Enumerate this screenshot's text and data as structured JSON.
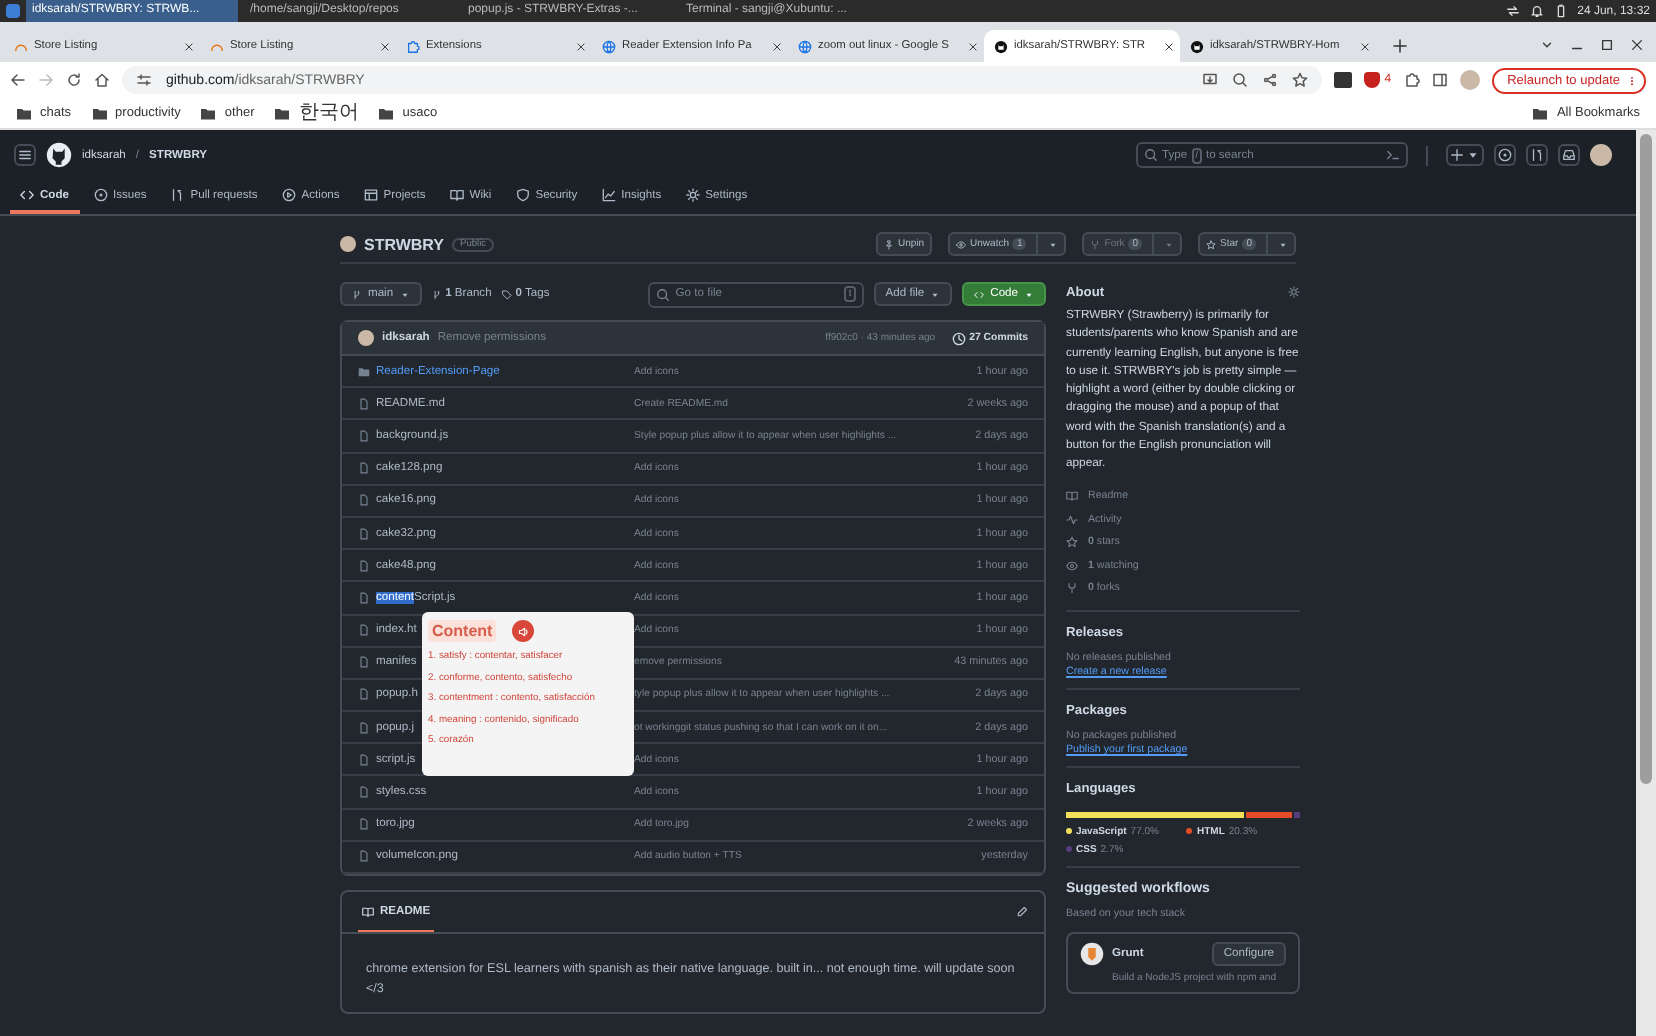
{
  "taskbar": {
    "windows": [
      {
        "title": "idksarah/STRWBRY: STRWB...",
        "selected": true
      },
      {
        "title": "/home/sangji/Desktop/repos",
        "selected": false
      },
      {
        "title": "popup.js - STRWBRY-Extras -...",
        "selected": false
      },
      {
        "title": "Terminal - sangji@Xubuntu: ...",
        "selected": false
      }
    ],
    "clock": "24 Jun, 13:32"
  },
  "browser": {
    "tabs": [
      {
        "title": "Store Listing",
        "selected": false
      },
      {
        "title": "Store Listing",
        "selected": false
      },
      {
        "title": "Extensions",
        "selected": false
      },
      {
        "title": "Reader Extension Info Pa",
        "selected": false
      },
      {
        "title": "zoom out linux - Google S",
        "selected": false
      },
      {
        "title": "idksarah/STRWBRY: STR",
        "selected": true
      },
      {
        "title": "idksarah/STRWBRY-Hom",
        "selected": false
      }
    ],
    "address": {
      "host": "github.com",
      "path": "/idksarah/STRWBRY"
    },
    "extension_badge": "4",
    "relaunch_button": "Relaunch to update",
    "bookmarks": [
      "chats",
      "productivity",
      "other",
      "한국어",
      "usaco"
    ],
    "all_bookmarks": "All Bookmarks"
  },
  "github": {
    "breadcrumb": {
      "owner": "idksarah",
      "separator": "/",
      "repo": "STRWBRY"
    },
    "search": {
      "before": "Type",
      "key": "/",
      "after": "to search"
    },
    "nav": [
      {
        "label": "Code",
        "selected": true
      },
      {
        "label": "Issues",
        "selected": false
      },
      {
        "label": "Pull requests",
        "selected": false
      },
      {
        "label": "Actions",
        "selected": false
      },
      {
        "label": "Projects",
        "selected": false
      },
      {
        "label": "Wiki",
        "selected": false
      },
      {
        "label": "Security",
        "selected": false
      },
      {
        "label": "Insights",
        "selected": false
      },
      {
        "label": "Settings",
        "selected": false
      }
    ],
    "repo": {
      "name": "STRWBRY",
      "visibility": "Public",
      "actions": [
        {
          "label": "Unpin",
          "disabled": false
        },
        {
          "label": "Unwatch",
          "count": "1",
          "disabled": false
        },
        {
          "label": "Fork",
          "count": "0",
          "disabled": true
        },
        {
          "label": "Star",
          "count": "0",
          "disabled": false
        }
      ]
    },
    "branch_bar": {
      "branch": "main",
      "branches": "**1** Branch",
      "tags": "**0** Tags",
      "go_to_file": {
        "placeholder": "Go to file",
        "key": "t"
      },
      "add_file": "Add file",
      "code_button": "Code"
    },
    "latest_commit": {
      "author": "idksarah",
      "message": "Remove permissions",
      "meta": "ff902c0 · 43 minutes ago",
      "commits": "27 Commits"
    },
    "files": [
      {
        "kind": "folder",
        "name": "Reader-Extension-Page",
        "message": "Add icons",
        "time": "1 hour ago"
      },
      {
        "kind": "file",
        "name": "README.md",
        "message": "Create README.md",
        "time": "2 weeks ago"
      },
      {
        "kind": "file",
        "name": "background.js",
        "message": "Style popup plus allow it to appear when user highlights ...",
        "time": "2 days ago"
      },
      {
        "kind": "file",
        "name": "cake128.png",
        "message": "Add icons",
        "time": "1 hour ago"
      },
      {
        "kind": "file",
        "name": "cake16.png",
        "message": "Add icons",
        "time": "1 hour ago"
      },
      {
        "kind": "file",
        "name": "cake32.png",
        "message": "Add icons",
        "time": "1 hour ago"
      },
      {
        "kind": "file",
        "name": "cake48.png",
        "message": "Add icons",
        "time": "1 hour ago"
      },
      {
        "kind": "file",
        "name_parts": [
          {
            "text": "content",
            "highlighted": true
          },
          {
            "text": "Script.js",
            "highlighted": false
          }
        ],
        "message": "Add icons",
        "time": "1 hour ago"
      },
      {
        "kind": "file",
        "name": "index.ht",
        "message": "Add icons",
        "time": "1 hour ago"
      },
      {
        "kind": "file",
        "name": "manifes",
        "message": "emove permissions",
        "time": "43 minutes ago"
      },
      {
        "kind": "file",
        "name": "popup.h",
        "message": "tyle popup plus allow it to appear when user highlights ...",
        "time": "2 days ago"
      },
      {
        "kind": "file",
        "name": "popup.j",
        "message": "ot workinggit status pushing so that I can work on it on...",
        "time": "2 days ago"
      },
      {
        "kind": "file",
        "name": "script.js",
        "message": "Add icons",
        "time": "1 hour ago"
      },
      {
        "kind": "file",
        "name": "styles.css",
        "message": "Add icons",
        "time": "1 hour ago"
      },
      {
        "kind": "file",
        "name": "toro.jpg",
        "message": "Add toro.jpg",
        "time": "2 weeks ago"
      },
      {
        "kind": "file",
        "name": "volumeIcon.png",
        "message": "Add audio button + TTS",
        "time": "yesterday"
      }
    ],
    "popup": {
      "word": "Content",
      "meanings": [
        "1. satisfy : contentar, satisfacer",
        "2. conforme, contento, satisfecho",
        "3. contentment : contento, satisfacción",
        "4. meaning : contenido, significado",
        "5. corazón"
      ]
    },
    "readme": {
      "title": "README",
      "text": "chrome extension for ESL learners with spanish as their native language. built in... not enough time. will update soon </3"
    },
    "about": {
      "title": "About",
      "description": "STRWBRY (Strawberry) is primarily for students/parents who know Spanish and are currently learning English, but anyone is free to use it. STRWBRY's job is pretty simple — highlight a word (either by double clicking or dragging the mouse) and a popup of that word with the Spanish translation(s) and a button for the English pronunciation will appear.",
      "links": [
        "Readme",
        "Activity",
        "**0** stars",
        "**1** watching",
        "**0** forks"
      ]
    },
    "releases": {
      "title": "Releases",
      "note": "No releases published",
      "link": "Create a new release"
    },
    "packages": {
      "title": "Packages",
      "note": "No packages published",
      "link": "Publish your first package"
    },
    "languages": {
      "title": "Languages",
      "items": [
        {
          "name": "JavaScript",
          "percent": "77.0%",
          "level": 0.77,
          "color": "#f1e05a"
        },
        {
          "name": "HTML",
          "percent": "20.3%",
          "level": 0.203,
          "color": "#e34c26"
        },
        {
          "name": "CSS",
          "percent": "2.7%",
          "level": 0.027,
          "color": "#563d7c"
        }
      ]
    },
    "workflows": {
      "title": "Suggested workflows",
      "subtitle": "Based on your tech stack",
      "cards": [
        {
          "name": "Grunt",
          "button": "Configure",
          "description": "Build a NodeJS project with npm and"
        }
      ]
    }
  }
}
